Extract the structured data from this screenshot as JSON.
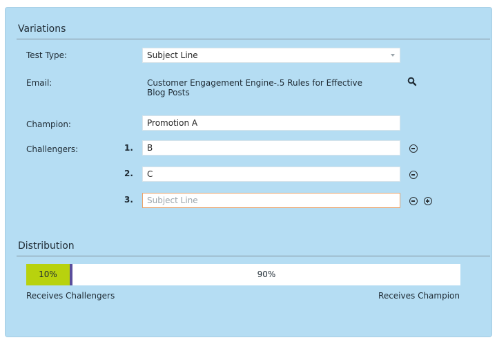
{
  "variations": {
    "title": "Variations",
    "test_type": {
      "label": "Test Type:",
      "value": "Subject Line"
    },
    "email": {
      "label": "Email:",
      "value_line1": "Customer Engagement Engine-.5 Rules for Effective",
      "value_line2": "Blog Posts",
      "icon": "search-icon"
    },
    "champion": {
      "label": "Champion:",
      "value": "Promotion A"
    },
    "challengers": {
      "label": "Challengers:",
      "items": [
        {
          "num": "1.",
          "value": "B"
        },
        {
          "num": "2.",
          "value": "C"
        },
        {
          "num": "3.",
          "value": "",
          "placeholder": "Subject Line"
        }
      ]
    }
  },
  "distribution": {
    "title": "Distribution",
    "challenger_percent": "10%",
    "champion_percent": "90%",
    "challenger_fraction": 0.1,
    "left_label": "Receives Challengers",
    "right_label": "Receives Champion",
    "colors": {
      "challenger": "#b8d20e",
      "handle": "#5a4e9c",
      "champion": "#ffffff"
    }
  }
}
